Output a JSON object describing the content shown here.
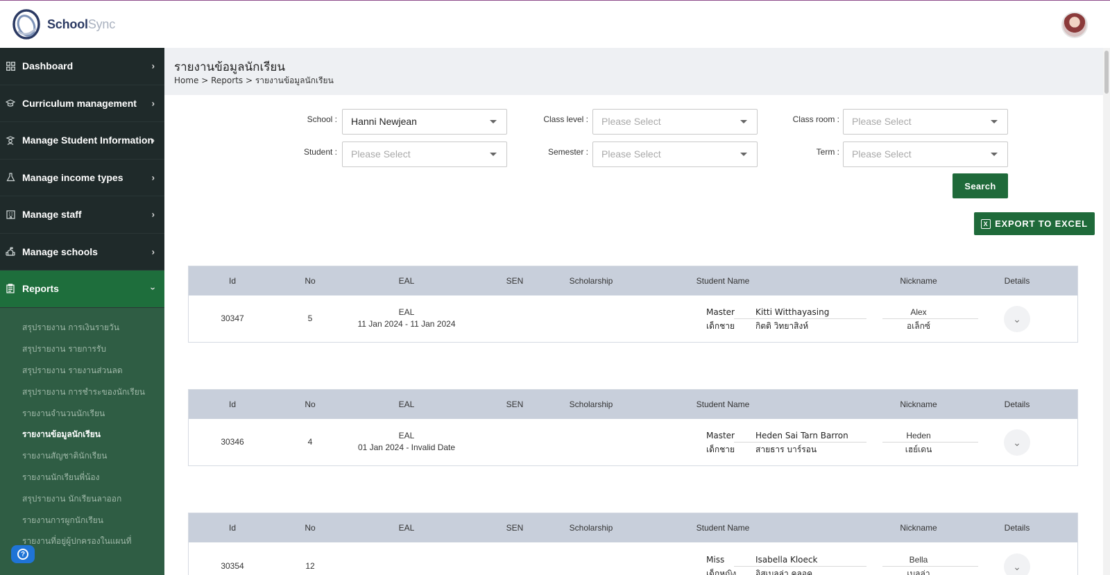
{
  "app": {
    "name_part1": "School",
    "name_part2": "Sync"
  },
  "sidebar": {
    "items": [
      {
        "label": "Dashboard",
        "icon": "grid-icon"
      },
      {
        "label": "Curriculum management",
        "icon": "graduation-cap-icon"
      },
      {
        "label": "Manage Student Information",
        "icon": "student-icon"
      },
      {
        "label": "Manage income types",
        "icon": "flask-icon"
      },
      {
        "label": "Manage staff",
        "icon": "building-icon"
      },
      {
        "label": "Manage schools",
        "icon": "school-icon"
      },
      {
        "label": "Reports",
        "icon": "clipboard-icon"
      }
    ],
    "report_subitems": [
      "สรุปรายงาน การเงินรายวัน",
      "สรุปรายงาน รายการรับ",
      "สรุปรายงาน รายงานส่วนลด",
      "สรุปรายงาน การชำระของนักเรียน",
      "รายงานจำนวนนักเรียน",
      "รายงานข้อมูลนักเรียน",
      "รายงานสัญชาตินักเรียน",
      "รายงานนักเรียนพี่น้อง",
      "สรุปรายงาน นักเรียนลาออก",
      "รายงานการผูกนักเรียน",
      "รายงานที่อยู่ผู้ปกครองในแผนที่"
    ]
  },
  "page": {
    "title": "รายงานข้อมูลนักเรียน",
    "breadcrumb": "Home > Reports > รายงานข้อมูลนักเรียน"
  },
  "filters": {
    "school_label": "School :",
    "school_value": "Hanni Newjean",
    "class_level_label": "Class level :",
    "class_level_placeholder": "Please Select",
    "class_room_label": "Class room :",
    "class_room_placeholder": "Please Select",
    "student_label": "Student :",
    "student_placeholder": "Please Select",
    "semester_label": "Semester :",
    "semester_placeholder": "Please Select",
    "term_label": "Term :",
    "term_placeholder": "Please Select",
    "search_label": "Search",
    "export_label": "EXPORT TO EXCEL"
  },
  "table": {
    "headers": [
      "Id",
      "No",
      "EAL",
      "SEN",
      "Scholarship",
      "Student Name",
      "Nickname",
      "Details"
    ],
    "rows": [
      {
        "id": "30347",
        "no": "5",
        "eal": "EAL",
        "eal_dates": "11 Jan 2024 - 11 Jan 2024",
        "sen": "",
        "scholarship": "",
        "title_en": "Master",
        "name_en": "Kitti Witthayasing",
        "title_th": "เด็กชาย",
        "name_th": "กิตติ วิทยาสิงห์",
        "nick_en": "Alex",
        "nick_th": "อเล็กซ์"
      },
      {
        "id": "30346",
        "no": "4",
        "eal": "EAL",
        "eal_dates": "01 Jan 2024 - Invalid Date",
        "sen": "",
        "scholarship": "",
        "title_en": "Master",
        "name_en": "Heden Sai Tarn Barron",
        "title_th": "เด็กชาย",
        "name_th": "สายธาร บาร์รอน",
        "nick_en": "Heden",
        "nick_th": "เฮย์เดน"
      },
      {
        "id": "30354",
        "no": "12",
        "eal": "",
        "eal_dates": "",
        "sen": "",
        "scholarship": "",
        "title_en": "Miss",
        "name_en": "Isabella Kloeck",
        "title_th": "เด็กหญิง",
        "name_th": "อิสเบลล่า คลอค",
        "nick_en": "Bella",
        "nick_th": "เบลล่า"
      }
    ]
  }
}
